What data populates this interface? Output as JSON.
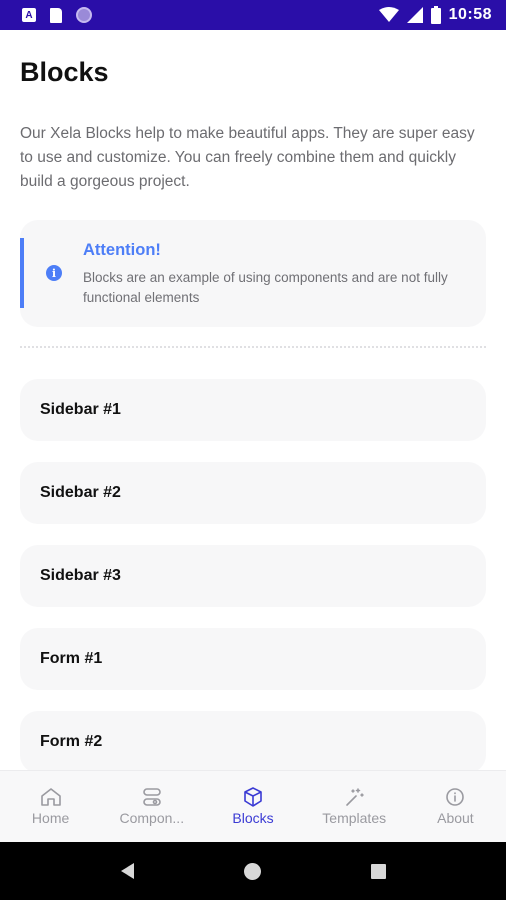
{
  "status_bar": {
    "time": "10:58",
    "left_icons": [
      "a-icon",
      "sd-card-icon",
      "circle-icon"
    ],
    "right_icons": [
      "wifi-icon",
      "signal-icon",
      "battery-icon"
    ],
    "a_glyph": "A"
  },
  "page": {
    "title": "Blocks",
    "intro": "Our Xela Blocks help to make beautiful apps. They are super easy to use and customize. You can freely combine them and quickly build a gorgeous project."
  },
  "alert": {
    "title": "Attention!",
    "text": "Blocks are an example of using components and are not fully functional elements",
    "icon": "info-icon",
    "icon_glyph": "i",
    "accent_color": "#4d7ef7"
  },
  "list": {
    "items": [
      {
        "label": "Sidebar #1"
      },
      {
        "label": "Sidebar #2"
      },
      {
        "label": "Sidebar #3"
      },
      {
        "label": "Form #1"
      },
      {
        "label": "Form #2"
      }
    ]
  },
  "tabs": [
    {
      "label": "Home",
      "icon": "home-icon",
      "active": false
    },
    {
      "label": "Compon...",
      "icon": "components-icon",
      "active": false
    },
    {
      "label": "Blocks",
      "icon": "cube-icon",
      "active": true
    },
    {
      "label": "Templates",
      "icon": "magic-wand-icon",
      "active": false
    },
    {
      "label": "About",
      "icon": "info-icon",
      "active": false
    }
  ],
  "colors": {
    "status_bar": "#2a0ea8",
    "active_tab": "#3b3bd4",
    "inactive_tab": "#9a9aa0"
  }
}
